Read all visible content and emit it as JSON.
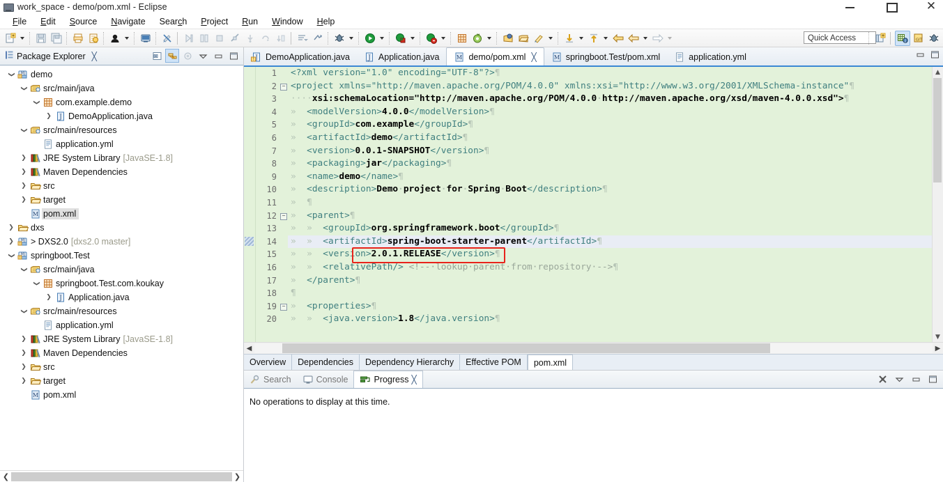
{
  "window": {
    "title": "work_space - demo/pom.xml - Eclipse",
    "app_icon": "eclipse-icon",
    "minimize": "minimize-icon",
    "maximize": "maximize-icon",
    "close": "close-icon"
  },
  "menubar": {
    "items": [
      {
        "label": "File",
        "mnemonic": "F"
      },
      {
        "label": "Edit",
        "mnemonic": "E"
      },
      {
        "label": "Source",
        "mnemonic": "S"
      },
      {
        "label": "Navigate",
        "mnemonic": "N"
      },
      {
        "label": "Search",
        "mnemonic": "c"
      },
      {
        "label": "Project",
        "mnemonic": "P"
      },
      {
        "label": "Run",
        "mnemonic": "R"
      },
      {
        "label": "Window",
        "mnemonic": "W"
      },
      {
        "label": "Help",
        "mnemonic": "H"
      }
    ]
  },
  "toolbar": {
    "quick_access_placeholder": "Quick Access",
    "buttons": [
      "new-wizard-icon",
      "save-icon",
      "save-all-icon",
      "print-icon",
      "build-icon",
      "open-type-icon",
      "new-java-class-icon",
      "toggle-mark-occurrences-icon",
      "skip-breakpoints-icon",
      "step-over-icon",
      "resume-icon",
      "terminate-icon",
      "profile-icon",
      "debug-icon",
      "run-icon",
      "coverage-icon",
      "new-annotation-icon",
      "search-icon",
      "open-resource-icon",
      "open-perspective-icon",
      "next-annotation-icon",
      "previous-annotation-icon",
      "back-icon",
      "forward-icon"
    ],
    "perspective_buttons": [
      "open-perspective-icon",
      "java-perspective-icon",
      "git-perspective-icon",
      "debug-perspective-icon"
    ]
  },
  "explorer": {
    "title": "Package Explorer",
    "close": "close-icon",
    "actions": [
      "collapse-all-icon",
      "link-with-editor-icon",
      "focus-on-active-task-icon",
      "view-menu-icon",
      "minimize-icon",
      "maximize-icon"
    ],
    "tree": [
      {
        "indent": 0,
        "twist": "v",
        "icon": "maven-project-icon",
        "label": "demo",
        "suffix": ""
      },
      {
        "indent": 1,
        "twist": "v",
        "icon": "source-folder-icon",
        "label": "src/main/java",
        "suffix": ""
      },
      {
        "indent": 2,
        "twist": "v",
        "icon": "package-icon",
        "label": "com.example.demo",
        "suffix": ""
      },
      {
        "indent": 3,
        "twist": ">",
        "icon": "java-file-icon",
        "label": "DemoApplication.java",
        "suffix": ""
      },
      {
        "indent": 1,
        "twist": "v",
        "icon": "source-folder-icon",
        "label": "src/main/resources",
        "suffix": ""
      },
      {
        "indent": 2,
        "twist": "",
        "icon": "yml-file-icon",
        "label": "application.yml",
        "suffix": ""
      },
      {
        "indent": 1,
        "twist": ">",
        "icon": "library-icon",
        "label": "JRE System Library",
        "suffix": "[JavaSE-1.8]"
      },
      {
        "indent": 1,
        "twist": ">",
        "icon": "library-icon",
        "label": "Maven Dependencies",
        "suffix": ""
      },
      {
        "indent": 1,
        "twist": ">",
        "icon": "folder-icon",
        "label": "src",
        "suffix": ""
      },
      {
        "indent": 1,
        "twist": ">",
        "icon": "folder-icon",
        "label": "target",
        "suffix": ""
      },
      {
        "indent": 1,
        "twist": "",
        "icon": "maven-pom-icon",
        "label": "pom.xml",
        "suffix": "",
        "selected": true
      },
      {
        "indent": 0,
        "twist": ">",
        "icon": "folder-icon",
        "label": "dxs",
        "suffix": ""
      },
      {
        "indent": 0,
        "twist": ">",
        "icon": "maven-project-icon",
        "label": "> DXS2.0",
        "suffix": "[dxs2.0 master]"
      },
      {
        "indent": 0,
        "twist": "v",
        "icon": "maven-project-icon",
        "label": "springboot.Test",
        "suffix": ""
      },
      {
        "indent": 1,
        "twist": "v",
        "icon": "source-folder-icon",
        "label": "src/main/java",
        "suffix": ""
      },
      {
        "indent": 2,
        "twist": "v",
        "icon": "package-icon",
        "label": "springboot.Test.com.koukay",
        "suffix": ""
      },
      {
        "indent": 3,
        "twist": ">",
        "icon": "java-file-icon",
        "label": "Application.java",
        "suffix": ""
      },
      {
        "indent": 1,
        "twist": "v",
        "icon": "source-folder-icon",
        "label": "src/main/resources",
        "suffix": ""
      },
      {
        "indent": 2,
        "twist": "",
        "icon": "yml-file-icon",
        "label": "application.yml",
        "suffix": ""
      },
      {
        "indent": 1,
        "twist": ">",
        "icon": "library-icon",
        "label": "JRE System Library",
        "suffix": "[JavaSE-1.8]"
      },
      {
        "indent": 1,
        "twist": ">",
        "icon": "library-icon",
        "label": "Maven Dependencies",
        "suffix": ""
      },
      {
        "indent": 1,
        "twist": ">",
        "icon": "folder-icon",
        "label": "src",
        "suffix": ""
      },
      {
        "indent": 1,
        "twist": ">",
        "icon": "folder-icon",
        "label": "target",
        "suffix": ""
      },
      {
        "indent": 1,
        "twist": "",
        "icon": "maven-pom-icon",
        "label": "pom.xml",
        "suffix": ""
      }
    ],
    "scroll_left": "❮",
    "scroll_right": "❯"
  },
  "editor": {
    "tabs": [
      {
        "label": "DemoApplication.java",
        "icon": "java-file-warning-icon",
        "active": false,
        "closeable": false
      },
      {
        "label": "Application.java",
        "icon": "java-file-icon",
        "active": false,
        "closeable": false
      },
      {
        "label": "demo/pom.xml",
        "icon": "maven-pom-icon",
        "active": true,
        "closeable": true
      },
      {
        "label": "springboot.Test/pom.xml",
        "icon": "maven-pom-icon",
        "active": false,
        "closeable": false
      },
      {
        "label": "application.yml",
        "icon": "yml-file-icon",
        "active": false,
        "closeable": false
      }
    ],
    "minimize": "minimize-icon",
    "maximize": "maximize-icon",
    "current_line": 14,
    "annotated_line": 15,
    "lines": [
      {
        "n": 1,
        "fold": "",
        "text": "<?xml version=\"1.0\" encoding=\"UTF-8\"?>"
      },
      {
        "n": 2,
        "fold": "-",
        "text": "<project xmlns=\"http://maven.apache.org/POM/4.0.0\" xmlns:xsi=\"http://www.w3.org/2001/XMLSchema-instance\""
      },
      {
        "n": 3,
        "fold": "",
        "text": "    xsi:schemaLocation=\"http://maven.apache.org/POM/4.0.0 http://maven.apache.org/xsd/maven-4.0.0.xsd\">"
      },
      {
        "n": 4,
        "fold": "",
        "text": "  <modelVersion>4.0.0</modelVersion>"
      },
      {
        "n": 5,
        "fold": "",
        "text": "  <groupId>com.example</groupId>"
      },
      {
        "n": 6,
        "fold": "",
        "text": "  <artifactId>demo</artifactId>"
      },
      {
        "n": 7,
        "fold": "",
        "text": "  <version>0.0.1-SNAPSHOT</version>"
      },
      {
        "n": 8,
        "fold": "",
        "text": "  <packaging>jar</packaging>"
      },
      {
        "n": 9,
        "fold": "",
        "text": "  <name>demo</name>"
      },
      {
        "n": 10,
        "fold": "",
        "text": "  <description>Demo project for Spring Boot</description>"
      },
      {
        "n": 11,
        "fold": "",
        "text": "  "
      },
      {
        "n": 12,
        "fold": "-",
        "text": "  <parent>"
      },
      {
        "n": 13,
        "fold": "",
        "text": "    <groupId>org.springframework.boot</groupId>"
      },
      {
        "n": 14,
        "fold": "",
        "text": "    <artifactId>spring-boot-starter-parent</artifactId>"
      },
      {
        "n": 15,
        "fold": "",
        "text": "    <version>2.0.1.RELEASE</version>"
      },
      {
        "n": 16,
        "fold": "",
        "text": "    <relativePath/> <!-- lookup parent from repository -->"
      },
      {
        "n": 17,
        "fold": "",
        "text": "  </parent>"
      },
      {
        "n": 18,
        "fold": "",
        "text": ""
      },
      {
        "n": 19,
        "fold": "-",
        "text": "  <properties>"
      },
      {
        "n": 20,
        "fold": "",
        "text": "    <java.version>1.8</java.version>"
      }
    ],
    "pom_tabs": [
      {
        "label": "Overview",
        "active": false
      },
      {
        "label": "Dependencies",
        "active": false
      },
      {
        "label": "Dependency Hierarchy",
        "active": false
      },
      {
        "label": "Effective POM",
        "active": false
      },
      {
        "label": "pom.xml",
        "active": true
      }
    ]
  },
  "bottom": {
    "tabs": [
      {
        "label": "Search",
        "icon": "search-icon",
        "active": false,
        "closeable": false
      },
      {
        "label": "Console",
        "icon": "console-icon",
        "active": false,
        "closeable": false
      },
      {
        "label": "Progress",
        "icon": "progress-icon",
        "active": true,
        "closeable": true
      }
    ],
    "actions": [
      "remove-all-icon",
      "view-menu-icon",
      "minimize-icon",
      "maximize-icon"
    ],
    "message": "No operations to display at this time."
  },
  "colors": {
    "editor_bg": "#e3f2da",
    "accent": "#3a87d4",
    "annotation_box": "#e8231b",
    "current_line": "#e9edf5"
  }
}
